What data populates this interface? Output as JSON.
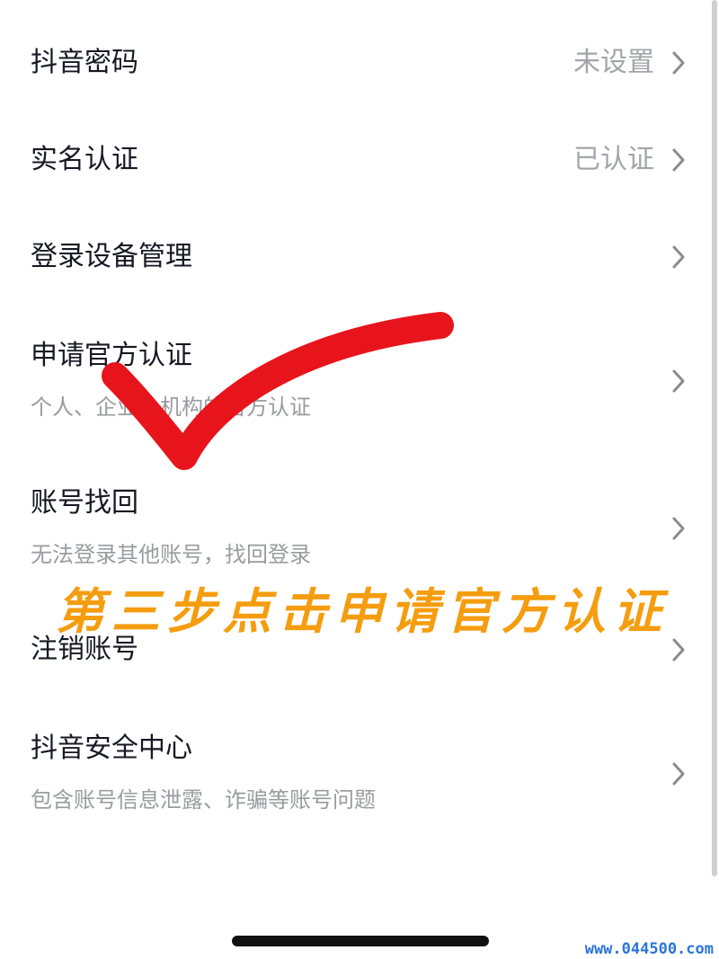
{
  "settings": {
    "items": [
      {
        "title": "抖音密码",
        "value": "未设置",
        "subtitle": ""
      },
      {
        "title": "实名认证",
        "value": "已认证",
        "subtitle": ""
      },
      {
        "title": "登录设备管理",
        "value": "",
        "subtitle": ""
      },
      {
        "title": "申请官方认证",
        "value": "",
        "subtitle": "个人、企业、机构的官方认证"
      },
      {
        "title": "账号找回",
        "value": "",
        "subtitle": "无法登录其他账号，找回登录"
      },
      {
        "title": "注销账号",
        "value": "",
        "subtitle": ""
      },
      {
        "title": "抖音安全中心",
        "value": "",
        "subtitle": "包含账号信息泄露、诈骗等账号问题"
      }
    ]
  },
  "annotation": {
    "text": "第三步点击申请官方认证",
    "color": "#f59d0f",
    "checkmark_color": "#e8141c"
  },
  "watermark": "www.044500.com",
  "icons": {
    "chevron": "chevron-right-icon"
  }
}
